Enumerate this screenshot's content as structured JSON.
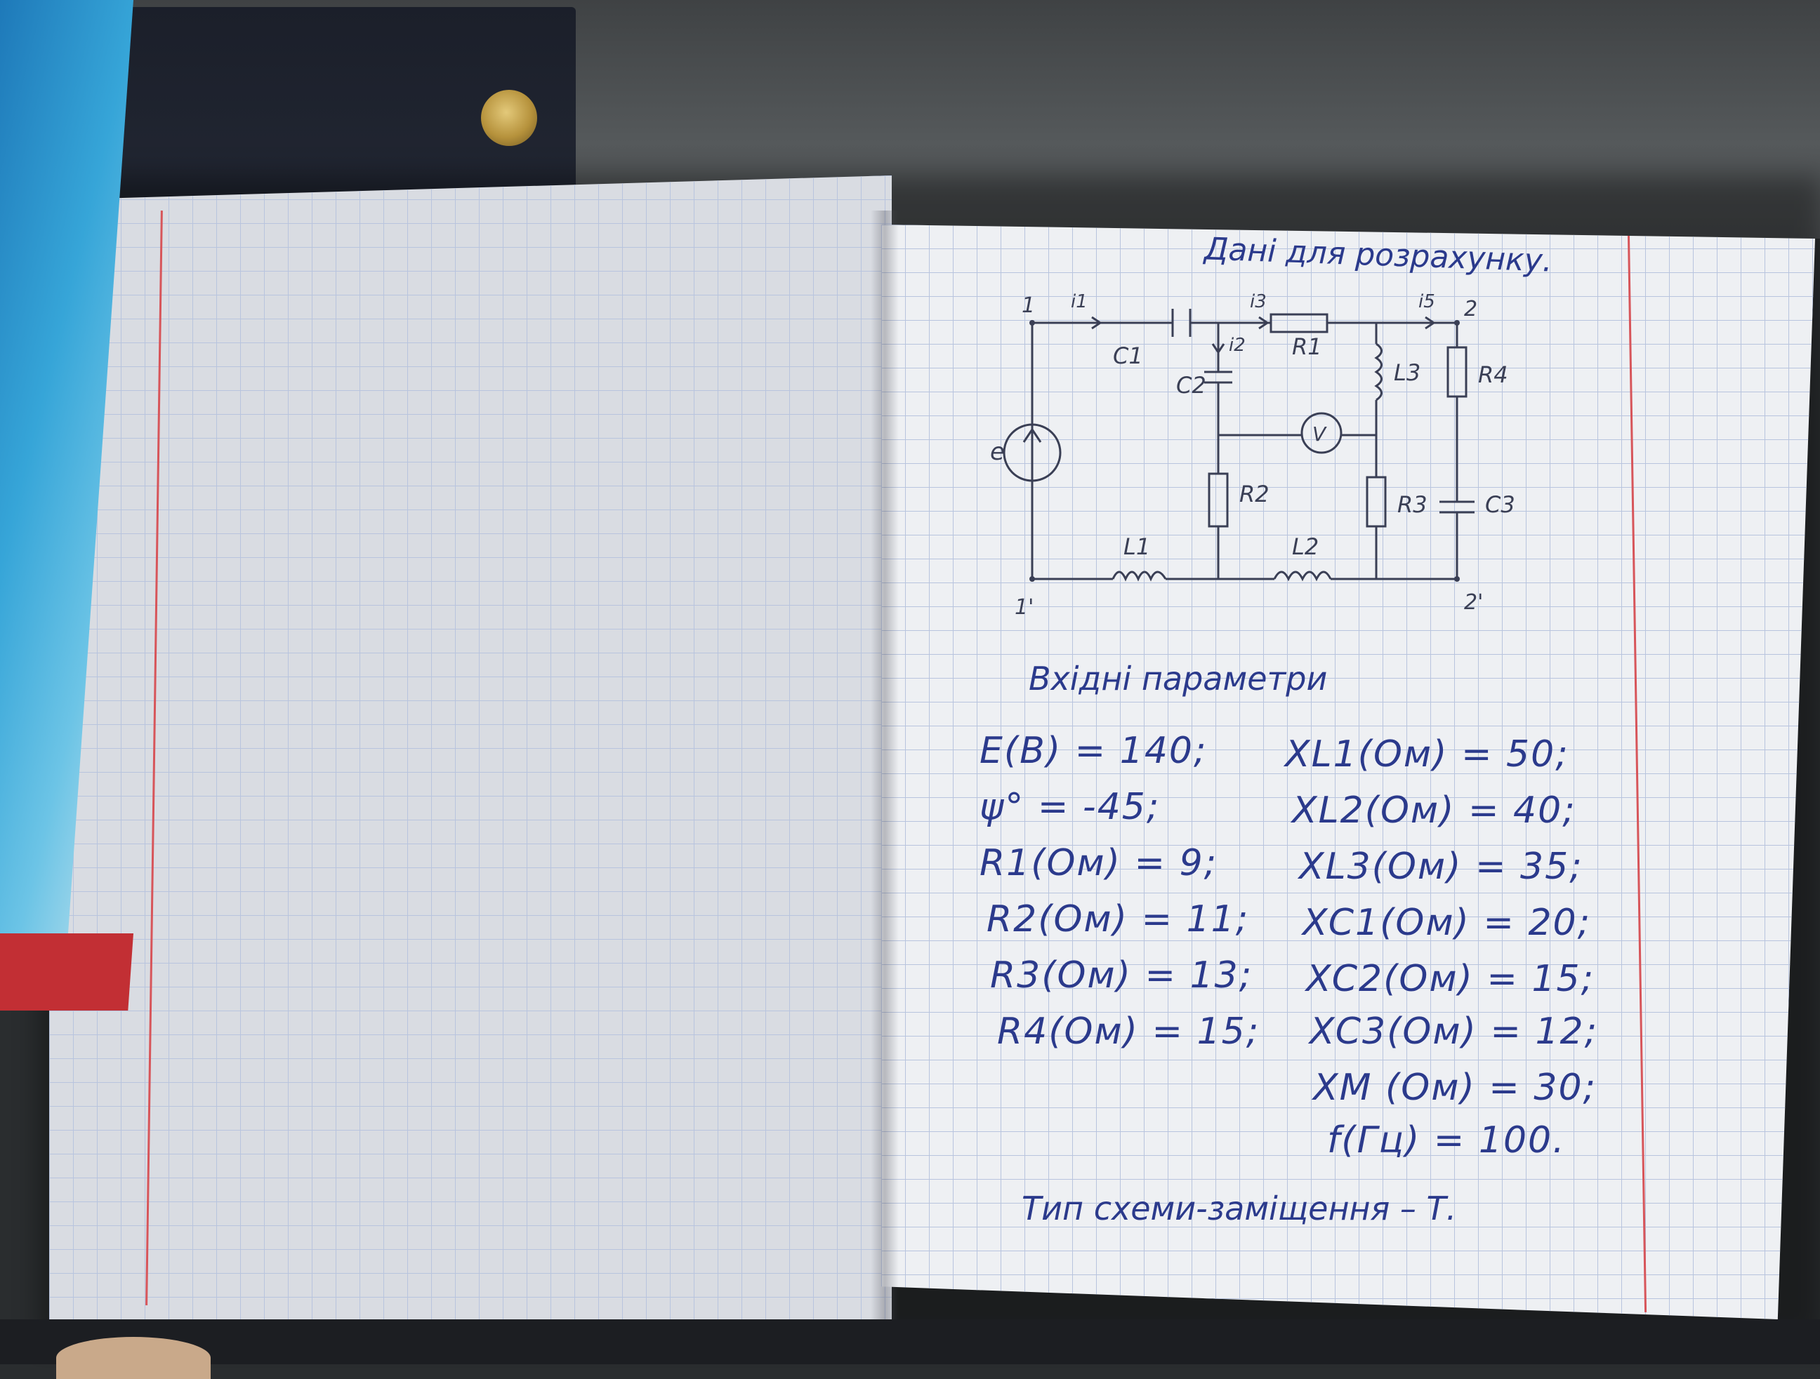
{
  "right_page": {
    "title": "Дані для розрахунку.",
    "inputs_heading": "Вхідні параметри",
    "scheme_type": "Тип схеми-заміщення – Т.",
    "params_left": [
      "E(B) = 140;",
      "ψ° = -45;",
      "R1(Ом) = 9;",
      "R2(Ом) = 11;",
      "R3(Ом) = 13;",
      "R4(Ом) = 15;"
    ],
    "params_right": [
      "XL1(Ом) = 50;",
      "XL2(Ом) = 40;",
      "XL3(Ом) = 35;",
      "XC1(Ом) = 20;",
      "XC2(Ом) = 15;",
      "XC3(Ом) = 12;",
      "XM (Ом) = 30;",
      "f(Гц) = 100."
    ],
    "circuit_labels": {
      "node_1": "1",
      "node_1p": "1'",
      "node_2": "2",
      "node_2p": "2'",
      "i1": "i1",
      "i2": "i2",
      "i3": "i3",
      "i5": "i5",
      "c1": "C1",
      "c2": "C2",
      "c3": "C3",
      "r1": "R1",
      "r2": "R2",
      "r3": "R3",
      "r4": "R4",
      "l1": "L1",
      "l2": "L2",
      "l3": "L3",
      "source": "e",
      "voltmeter": "V"
    }
  },
  "colors": {
    "ink": "#2b3a8c",
    "pencil": "#3a3f55",
    "grid": "#b8c4de",
    "margin_line": "#d7555a"
  }
}
